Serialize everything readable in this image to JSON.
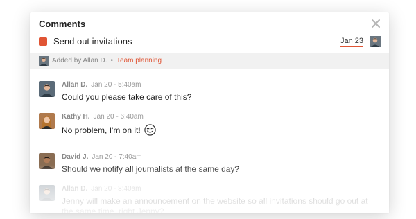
{
  "dialog": {
    "title": "Comments",
    "close_icon": "close-icon"
  },
  "task": {
    "name": "Send out invitations",
    "due_date": "Jan 23",
    "color": "#e05434",
    "assignee_avatar": "avatar"
  },
  "meta": {
    "added_by": "Added by Allan D.",
    "separator": "•",
    "project": "Team planning",
    "project_color": "#e05434"
  },
  "comments": [
    {
      "author": "Allan D.",
      "time": "Jan 20 - 5:40am",
      "text": "Could you please take care of this?",
      "avatar_color": "#5b6b78"
    },
    {
      "author": "Kathy H.",
      "time": "Jan 20 - 6:40am",
      "text": "No problem, I'm on it!",
      "emoji": "smiley-face-icon",
      "avatar_color": "#b07a4d"
    },
    {
      "author": "David J.",
      "time": "Jan 20 - 7:40am",
      "text": "Should we notify all journalists at the same day?",
      "avatar_color": "#6b4a34"
    },
    {
      "author": "Allan D.",
      "time": "Jan 20 - 8:40am",
      "text": "Jenny will make an announcement on the website so all invitations should go out at the same time, right Jenny?",
      "avatar_color": "#5b6b78"
    }
  ]
}
